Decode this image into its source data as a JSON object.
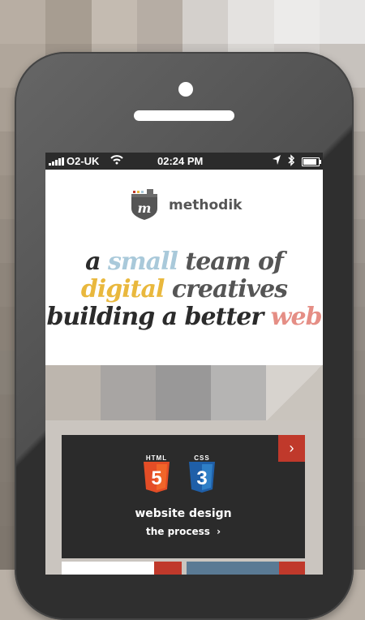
{
  "status_bar": {
    "carrier": "O2-UK",
    "time": "02:24 PM"
  },
  "header": {
    "brand": "methodik"
  },
  "tagline": {
    "line1": {
      "w1": "a",
      "w2": "small",
      "w3": "team",
      "w4": "of"
    },
    "line2": {
      "w1": "digital",
      "w2": "creatives"
    },
    "line3": {
      "w1": "building a better",
      "w2": "web"
    }
  },
  "card": {
    "badges": [
      {
        "label": "HTML",
        "number": "5",
        "color": "#e44d26"
      },
      {
        "label": "CSS",
        "number": "3",
        "color": "#2f7fc7"
      }
    ],
    "title": "website design",
    "link_label": "the process",
    "link_chevron": "›",
    "arrow": "›"
  },
  "icons": {
    "wifi": "wifi-icon",
    "location": "location-arrow-icon",
    "bluetooth": "bluetooth-icon",
    "battery": "battery-icon"
  },
  "colors": {
    "accent_red": "#c0392b",
    "accent_blue": "#a9c9da",
    "accent_yellow": "#e9b83d",
    "accent_pink": "#e58e85",
    "dark": "#2b2b2b"
  }
}
